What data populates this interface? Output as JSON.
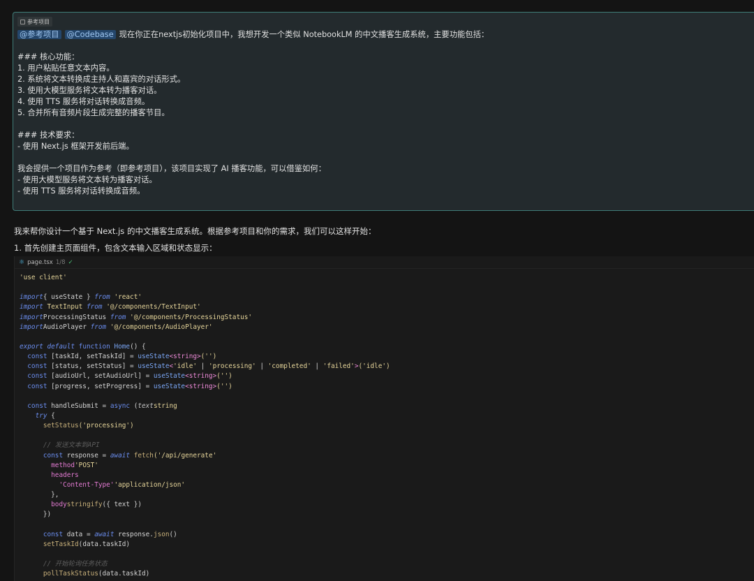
{
  "user_message": {
    "context_chip": "参考项目",
    "mentions": [
      "@参考项目",
      "@Codebase"
    ],
    "first_line": "现在你正在nextjs初始化项目中，我想开发一个类似 NotebookLM 的中文播客生成系统，主要功能包括：",
    "lines": [
      "### 核心功能：",
      "1. 用户粘贴任意文本内容。",
      "2. 系统将文本转换成主持人和嘉宾的对话形式。",
      "3. 使用大模型服务将文本转为播客对话。",
      "4. 使用 TTS 服务将对话转换成音频。",
      "5. 合并所有音频片段生成完整的播客节目。",
      "### 技术要求：",
      "- 使用 Next.js 框架开发前后端。",
      "我会提供一个项目作为参考（即参考项目），该项目实现了 AI 播客功能，可以借鉴如何：",
      "- 使用大模型服务将文本转为播客对话。",
      "- 使用 TTS 服务将对话转换成音频。"
    ]
  },
  "assistant_reply": {
    "intro": "我来帮你设计一个基于 Next.js 的中文播客生成系统。根据参考项目和你的需求，我们可以这样开始：",
    "step1": "1. 首先创建主页面组件，包含文本输入区域和状态显示："
  },
  "code_block": {
    "filename": "page.tsx",
    "version": "1/8",
    "check": "✓",
    "lines": [
      [
        [
          "st",
          "'use client'"
        ]
      ],
      [],
      [
        [
          "kw",
          "import"
        ],
        [
          "",
          "{ useState } "
        ],
        [
          "kw",
          "from"
        ],
        [
          "st",
          " 'react'"
        ]
      ],
      [
        [
          "kw",
          "import"
        ],
        [
          "st",
          " TextInput "
        ],
        [
          "kw",
          "from"
        ],
        [
          "st",
          " '@/components/TextInput'"
        ]
      ],
      [
        [
          "kw",
          "import"
        ],
        [
          "",
          "ProcessingStatus "
        ],
        [
          "kw",
          "from"
        ],
        [
          "st",
          " '@/components/ProcessingStatus'"
        ]
      ],
      [
        [
          "kw",
          "import"
        ],
        [
          "",
          "AudioPlayer "
        ],
        [
          "kw",
          "from"
        ],
        [
          "st",
          " '@/components/AudioPlayer'"
        ]
      ],
      [],
      [
        [
          "kw",
          "export default"
        ],
        [
          "kb",
          " function "
        ],
        [
          "fb",
          "Home"
        ],
        [
          "",
          "() {"
        ]
      ],
      [
        [
          "kb",
          "  const "
        ],
        [
          "",
          "[taskId, setTaskId] = "
        ],
        [
          "fb",
          "useState"
        ],
        [
          "tg",
          "<string>"
        ],
        [
          "st",
          "('')"
        ]
      ],
      [
        [
          "kb",
          "  const "
        ],
        [
          "",
          "[status, setStatus] = "
        ],
        [
          "fb",
          "useState"
        ],
        [
          "tg",
          "<"
        ],
        [
          "st",
          "'idle'"
        ],
        [
          "",
          " | "
        ],
        [
          "st",
          "'processing'"
        ],
        [
          "",
          " | "
        ],
        [
          "st",
          "'completed'"
        ],
        [
          "",
          " | "
        ],
        [
          "st",
          "'failed'"
        ],
        [
          "tg",
          ">"
        ],
        [
          "st",
          "('idle')"
        ]
      ],
      [
        [
          "kb",
          "  const "
        ],
        [
          "",
          "[audioUrl, setAudioUrl] = "
        ],
        [
          "fb",
          "useState"
        ],
        [
          "tg",
          "<string>"
        ],
        [
          "st",
          "('')"
        ]
      ],
      [
        [
          "kb",
          "  const "
        ],
        [
          "",
          "[progress, setProgress] = "
        ],
        [
          "fb",
          "useState"
        ],
        [
          "tg",
          "<string>"
        ],
        [
          "st",
          "('')"
        ]
      ],
      [],
      [
        [
          "kb",
          "  const "
        ],
        [
          "",
          "handleSubmit = "
        ],
        [
          "kb",
          "async "
        ],
        [
          "",
          "("
        ],
        [
          "pm",
          "text"
        ],
        [
          ": "
        ],
        [
          "ty",
          "string"
        ],
        [
          ") => {"
        ]
      ],
      [
        [
          "kw",
          "    try "
        ],
        [
          "",
          "{"
        ]
      ],
      [
        [
          "fn",
          "      setStatus"
        ],
        [
          "st",
          "('processing')"
        ]
      ],
      [],
      [
        [
          "cm",
          "      // 发送文本到API"
        ]
      ],
      [
        [
          "kb",
          "      const "
        ],
        [
          "",
          "response = "
        ],
        [
          "kw",
          "await "
        ],
        [
          "fn",
          "fetch"
        ],
        [
          "st",
          "('/api/generate'"
        ],
        [
          ", {"
        ]
      ],
      [
        [
          "pr",
          "        method"
        ],
        [
          ": "
        ],
        [
          "st",
          "'POST'"
        ],
        [
          ","
        ]
      ],
      [
        [
          "pr",
          "        headers"
        ],
        [
          ": {"
        ]
      ],
      [
        [
          "pr",
          "          'Content-Type'"
        ],
        [
          ": "
        ],
        [
          "st",
          "'application/json'"
        ],
        [
          ","
        ]
      ],
      [
        [
          "",
          "        },"
        ]
      ],
      [
        [
          "pr",
          "        body"
        ],
        [
          ": JSON."
        ],
        [
          "fn",
          "stringify"
        ],
        [
          "",
          "({ text })"
        ]
      ],
      [
        [
          "",
          "      })"
        ]
      ],
      [],
      [
        [
          "kb",
          "      const "
        ],
        [
          "",
          "data = "
        ],
        [
          "kw",
          "await "
        ],
        [
          "",
          "response."
        ],
        [
          "fn",
          "json"
        ],
        [
          "",
          "()"
        ]
      ],
      [
        [
          "fn",
          "      setTaskId"
        ],
        [
          "",
          "(data.taskId)"
        ]
      ],
      [],
      [
        [
          "cm",
          "      // 开始轮询任务状态"
        ]
      ],
      [
        [
          "fn",
          "      pollTaskStatus"
        ],
        [
          "",
          "(data.taskId)"
        ]
      ]
    ]
  }
}
